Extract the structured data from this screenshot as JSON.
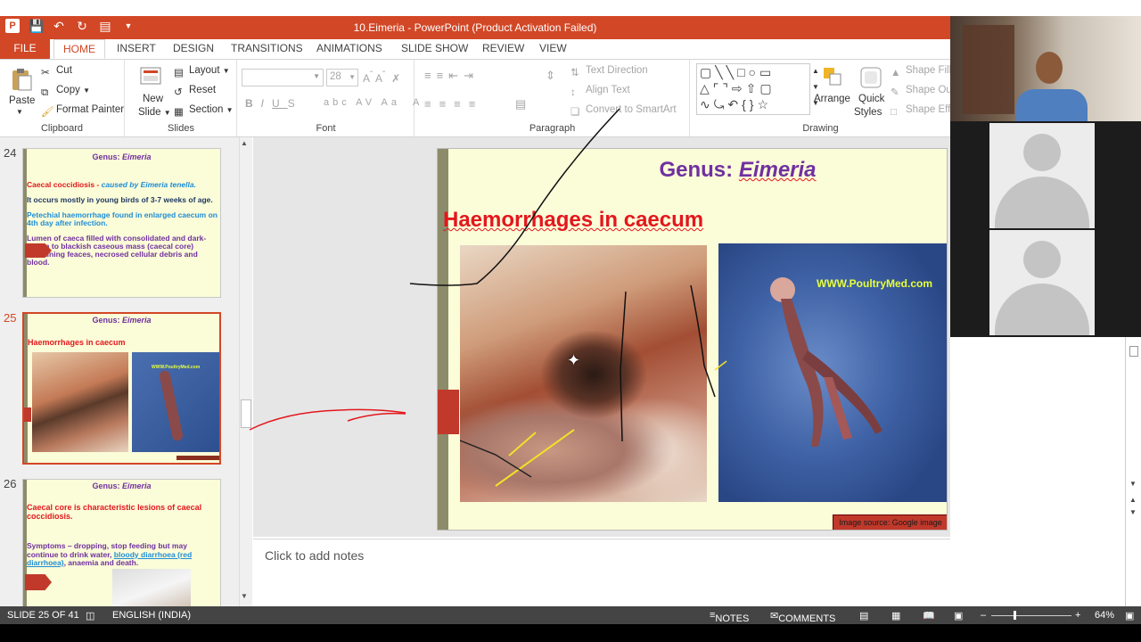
{
  "window": {
    "title": "10.Eimeria -  PowerPoint (Product Activation Failed)"
  },
  "tabs": [
    "FILE",
    "HOME",
    "INSERT",
    "DESIGN",
    "TRANSITIONS",
    "ANIMATIONS",
    "SLIDE SHOW",
    "REVIEW",
    "VIEW"
  ],
  "active_tab": "HOME",
  "ribbon": {
    "clipboard": {
      "label": "Clipboard",
      "paste": "Paste",
      "cut": "Cut",
      "copy": "Copy",
      "format_painter": "Format Painter"
    },
    "slides": {
      "label": "Slides",
      "new_slide_1": "New",
      "new_slide_2": "Slide",
      "layout": "Layout",
      "reset": "Reset",
      "section": "Section"
    },
    "font": {
      "label": "Font",
      "font_name": "",
      "font_size": "28"
    },
    "paragraph": {
      "label": "Paragraph",
      "text_direction": "Text Direction",
      "align_text": "Align Text",
      "convert_smartart": "Convert to SmartArt"
    },
    "drawing": {
      "label": "Drawing",
      "arrange": "Arrange",
      "quick_styles_1": "Quick",
      "quick_styles_2": "Styles",
      "shape_fill": "Shape Fill",
      "shape_outline": "Shape Ou",
      "shape_effects": "Shape Eff"
    }
  },
  "thumbnails": [
    {
      "number": "24",
      "title_plain": "Genus:",
      "title_italic": "Eimeria",
      "line1_red": "Caecal coccidiosis -",
      "line1_blue": "caused by Eimeria tenella.",
      "bullet1": "It occurs mostly in young birds of 3-7 weeks of age.",
      "bullet2": "Petechial haemorrhage found in enlarged caecum on 4th day after infection.",
      "bullet3": "Lumen of caeca filled with consolidated and dark-brown to blackish caseous mass (caecal core) containing feaces, necrosed cellular debris and blood."
    },
    {
      "number": "25",
      "title_plain": "Genus:",
      "title_italic": "Eimeria",
      "heading": "Haemorrhages in caecum",
      "watermark": "WWW.PoultryMed.com"
    },
    {
      "number": "26",
      "title_plain": "Genus:",
      "title_italic": "Eimeria",
      "bullet1": "Caecal core is characteristic lesions of caecal coccidiosis.",
      "bullet2_a": "Symptoms – dropping, stop feeding but may continue to drink water,",
      "bullet2_b": "bloody diarrhoea (red diarrhoea)",
      "bullet2_c": ", anaemia and death."
    }
  ],
  "slide": {
    "title_plain": "Genus:",
    "title_italic": "Eimeria",
    "heading": "Haemorrhages in caecum",
    "watermark": "WWW.PoultryMed.com",
    "image_source": "Image source: Google image"
  },
  "notes": {
    "placeholder": "Click to add notes"
  },
  "status": {
    "slide_info": "SLIDE 25 OF 41",
    "language": "ENGLISH (INDIA)",
    "notes": "NOTES",
    "comments": "COMMENTS",
    "zoom": "64%"
  },
  "colors": {
    "accent": "#d24726",
    "slide_bg": "#fbfcd8",
    "title_purple": "#7030a0",
    "heading_red": "#e3171d",
    "caption_bg": "#c0392b"
  }
}
